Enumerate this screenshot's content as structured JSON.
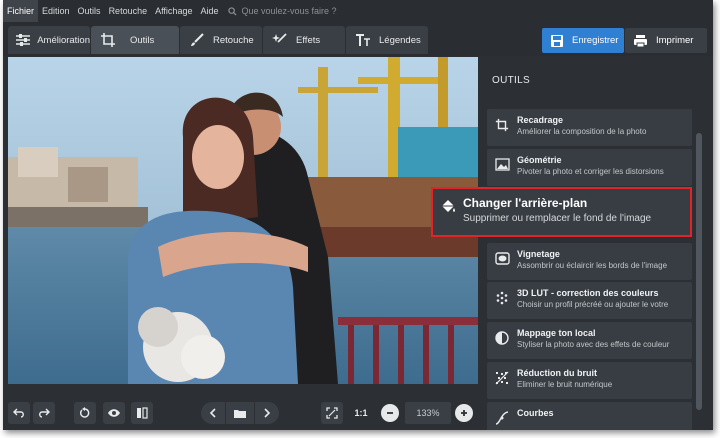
{
  "menubar": {
    "items": [
      "Fichier",
      "Edition",
      "Outils",
      "Retouche",
      "Affichage",
      "Aide"
    ],
    "search_placeholder": "Que voulez-vous faire ?"
  },
  "tabs": [
    {
      "label": "Amélioration",
      "icon": "sliders-icon"
    },
    {
      "label": "Outils",
      "icon": "crop-icon"
    },
    {
      "label": "Retouche",
      "icon": "brush-icon"
    },
    {
      "label": "Effets",
      "icon": "magic-wand-icon"
    },
    {
      "label": "Légendes",
      "icon": "text-icon"
    }
  ],
  "actions": {
    "save_label": "Enregistrer",
    "print_label": "Imprimer"
  },
  "bottombar": {
    "ratio_label": "1:1",
    "zoom_value": "133%"
  },
  "panel": {
    "title": "OUTILS",
    "tools": [
      {
        "name": "Recadrage",
        "desc": "Améliorer la composition de la photo",
        "icon": "crop-icon"
      },
      {
        "name": "Géométrie",
        "desc": "Pivoter la photo et corriger les distorsions",
        "icon": "image-icon"
      },
      {
        "name": "Changer l'arrière-plan",
        "desc": "Supprimer ou remplacer le fond de l'image",
        "icon": "paint-bucket-icon"
      },
      {
        "name": "Vignetage",
        "desc": "Assombrir ou éclaircir les bords de l'image",
        "icon": "vignette-icon"
      },
      {
        "name": "3D LUT - correction des couleurs",
        "desc": "Choisir un profil précréé ou ajouter le votre",
        "icon": "lut-icon"
      },
      {
        "name": "Mappage ton local",
        "desc": "Styliser la photo avec des effets de couleur",
        "icon": "contrast-icon"
      },
      {
        "name": "Réduction du bruit",
        "desc": "Eliminer le bruit numérique",
        "icon": "noise-icon"
      },
      {
        "name": "Courbes",
        "desc": "",
        "icon": "curves-icon"
      }
    ]
  },
  "colors": {
    "accent": "#2f7fd3",
    "highlight": "#e0252a",
    "bg": "#2c3035"
  }
}
